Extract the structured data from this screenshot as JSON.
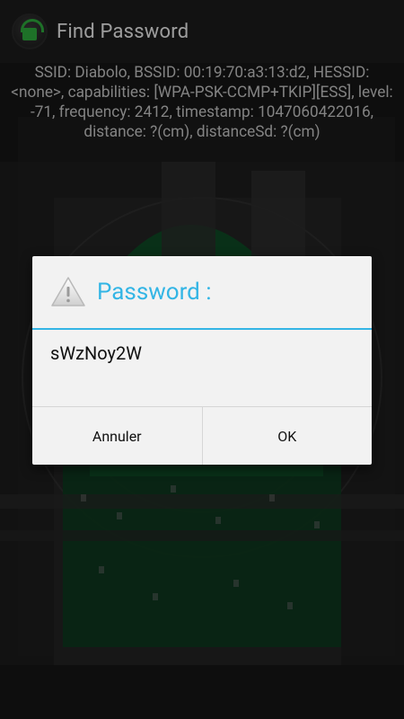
{
  "app": {
    "title": "Find Password",
    "icon": "wifi-lock-app-icon"
  },
  "wifi_info": {
    "text": "SSID: Diabolo, BSSID: 00:19:70:a3:13:d2, HESSID: <none>, capabilities: [WPA-PSK-CCMP+TKIP][ESS], level: -71, frequency: 2412, timestamp: 1047060422016, distance: ?(cm), distanceSd: ?(cm)"
  },
  "dialog": {
    "icon": "warning-icon",
    "title": "Password :",
    "password": "sWzNoy2W",
    "cancel_label": "Annuler",
    "ok_label": "OK"
  },
  "colors": {
    "accent": "#33b5e5",
    "brand_green": "#2fae3e",
    "dialog_bg": "#f2f2f2"
  }
}
